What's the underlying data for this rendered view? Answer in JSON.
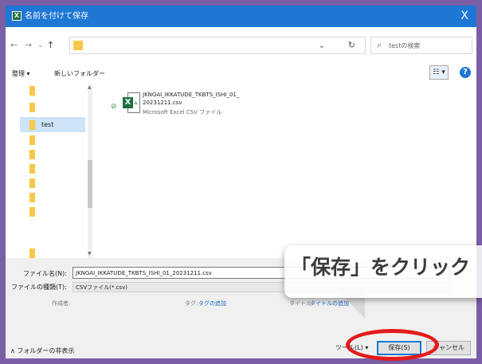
{
  "window": {
    "title": "名前を付けて保存",
    "close_glyph": "X",
    "app_icon_glyph": "X"
  },
  "nav": {
    "back": "←",
    "forward": "→",
    "dropdown": "⌄",
    "up": "↑",
    "address_dropdown": "⌄",
    "refresh": "↻"
  },
  "search": {
    "icon": "⌕",
    "placeholder": "testの検索"
  },
  "toolbar": {
    "organize": "整理 ▾",
    "new_folder": "新しいフォルダー",
    "view_glyph": "☷ ▾",
    "help_glyph": "?"
  },
  "nav_pane": {
    "selected_folder": "test"
  },
  "file": {
    "name_line1": "JKNGAI_IKKATUDE_TKBTS_ISHI_01_",
    "name_line2": "20231211.csv",
    "type": "Microsoft Excel CSV ファイル",
    "sync_status": "⊘"
  },
  "form": {
    "filename_label": "ファイル名(N):",
    "filename_value": "JKNGAI_IKKATUDE_TKBTS_ISHI_01_20231211.csv",
    "filetype_label": "ファイルの種類(T):",
    "filetype_value": "CSVファイル(*.csv)",
    "author_label": "作成者:",
    "tags_label": "タグ:",
    "tags_link": "タグの追加",
    "title_label": "タイトル:",
    "title_link": "タイトルの追加"
  },
  "bottom": {
    "hide_folders": "∧ フォルダーの非表示",
    "tools": "ツール(L) ▾",
    "save": "保存(S)",
    "cancel": "キャンセル"
  },
  "callout": {
    "text": "「保存」をクリック"
  },
  "colors": {
    "titlebar": "#1e77d3",
    "background": "#7a5ea6",
    "highlight": "#e31b1b",
    "link": "#1a66c7"
  }
}
